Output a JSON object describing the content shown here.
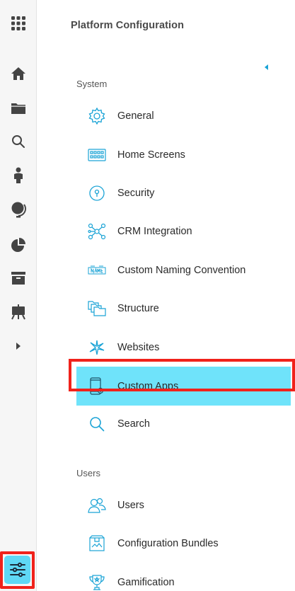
{
  "colors": {
    "accent": "#1aa3d6",
    "active_bg": "#6fe3fa",
    "highlight_outline": "#f0221b"
  },
  "rail": {
    "items": [
      {
        "icon": "apps-grid-icon"
      },
      {
        "icon": "home-icon"
      },
      {
        "icon": "folder-icon"
      },
      {
        "icon": "search-icon"
      },
      {
        "icon": "person-icon"
      },
      {
        "icon": "globe-icon"
      },
      {
        "icon": "pie-chart-icon"
      },
      {
        "icon": "archive-icon"
      },
      {
        "icon": "easel-icon"
      },
      {
        "icon": "expand-arrow-icon"
      },
      {
        "icon": "settings-sliders-icon"
      }
    ]
  },
  "panel": {
    "title": "Platform Configuration"
  },
  "sections": {
    "system": {
      "label": "System",
      "items": [
        {
          "label": "General",
          "icon": "gear-icon"
        },
        {
          "label": "Home Screens",
          "icon": "home-screens-icon"
        },
        {
          "label": "Security",
          "icon": "security-lock-icon"
        },
        {
          "label": "CRM Integration",
          "icon": "network-nodes-icon"
        },
        {
          "label": "Custom Naming Convention",
          "icon": "name-tag-icon"
        },
        {
          "label": "Structure",
          "icon": "structure-folders-icon"
        },
        {
          "label": "Websites",
          "icon": "websites-sparkle-icon"
        },
        {
          "label": "Custom Apps",
          "icon": "custom-apps-icon"
        },
        {
          "label": "Search",
          "icon": "search-icon"
        }
      ]
    },
    "users": {
      "label": "Users",
      "items": [
        {
          "label": "Users",
          "icon": "users-icon"
        },
        {
          "label": "Configuration Bundles",
          "icon": "bundle-box-icon"
        },
        {
          "label": "Gamification",
          "icon": "trophy-icon"
        }
      ]
    }
  }
}
